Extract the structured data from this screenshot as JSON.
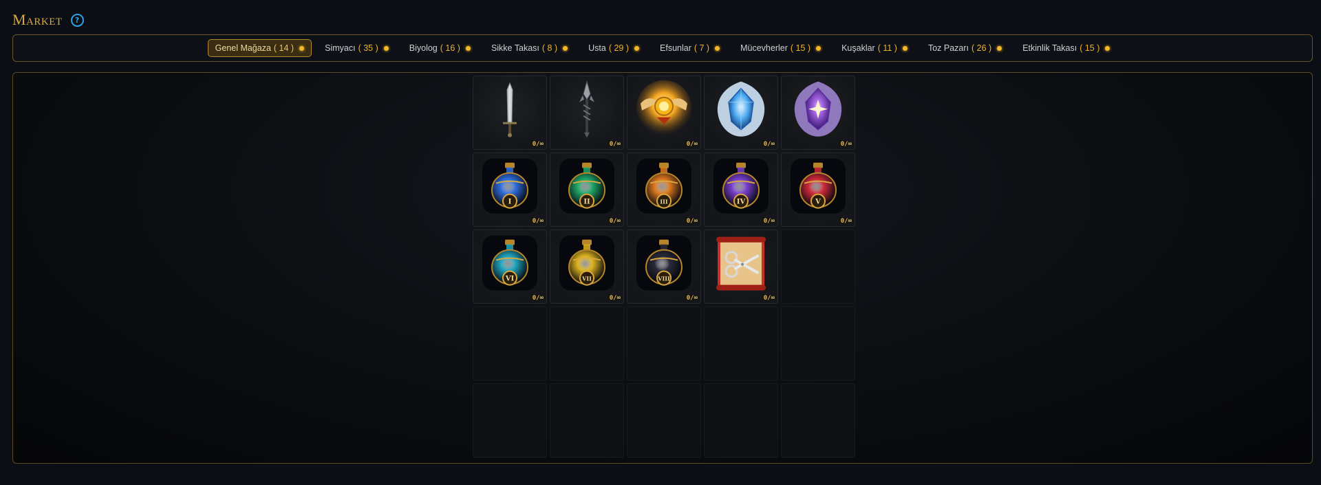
{
  "header": {
    "title": "Market",
    "help_glyph": "?"
  },
  "tabs": [
    {
      "label": "Genel Mağaza",
      "count": "( 14 )",
      "active": true
    },
    {
      "label": "Simyacı",
      "count": "( 35 )",
      "active": false
    },
    {
      "label": "Biyolog",
      "count": "( 16 )",
      "active": false
    },
    {
      "label": "Sikke Takası",
      "count": "( 8 )",
      "active": false
    },
    {
      "label": "Usta",
      "count": "( 29 )",
      "active": false
    },
    {
      "label": "Efsunlar",
      "count": "( 7 )",
      "active": false
    },
    {
      "label": "Mücevherler",
      "count": "( 15 )",
      "active": false
    },
    {
      "label": "Kuşaklar",
      "count": "( 11 )",
      "active": false
    },
    {
      "label": "Toz Pazarı",
      "count": "( 26 )",
      "active": false
    },
    {
      "label": "Etkinlik Takası",
      "count": "( 15 )",
      "active": false
    }
  ],
  "items": [
    {
      "icon": "sword-icon",
      "stock": "0/∞"
    },
    {
      "icon": "spear-icon",
      "stock": "0/∞"
    },
    {
      "icon": "winged-emblem-icon",
      "stock": "0/∞"
    },
    {
      "icon": "blue-crystal-icon",
      "stock": "0/∞"
    },
    {
      "icon": "purple-crystal-icon",
      "stock": "0/∞"
    },
    {
      "icon": "potion-icon",
      "numeral": "I",
      "color": "#2f6fe0",
      "stock": "0/∞"
    },
    {
      "icon": "potion-icon",
      "numeral": "II",
      "color": "#1fa86a",
      "stock": "0/∞"
    },
    {
      "icon": "potion-icon",
      "numeral": "III",
      "color": "#e07a1f",
      "stock": "0/∞"
    },
    {
      "icon": "potion-icon",
      "numeral": "IV",
      "color": "#7a3fd0",
      "stock": "0/∞"
    },
    {
      "icon": "potion-icon",
      "numeral": "V",
      "color": "#d02a3a",
      "stock": "0/∞"
    },
    {
      "icon": "potion-icon",
      "numeral": "VI",
      "color": "#1fa6c0",
      "stock": "0/∞"
    },
    {
      "icon": "potion-icon",
      "numeral": "VII",
      "color": "#e0b51f",
      "stock": "0/∞"
    },
    {
      "icon": "potion-icon",
      "numeral": "VIII",
      "color": "#2a2a3a",
      "stock": "0/∞"
    },
    {
      "icon": "scroll-scissors-icon",
      "stock": "0/∞"
    }
  ],
  "colors": {
    "accent": "#d9a93f",
    "dot": "#f3b72a",
    "help": "#2aa3e8"
  }
}
